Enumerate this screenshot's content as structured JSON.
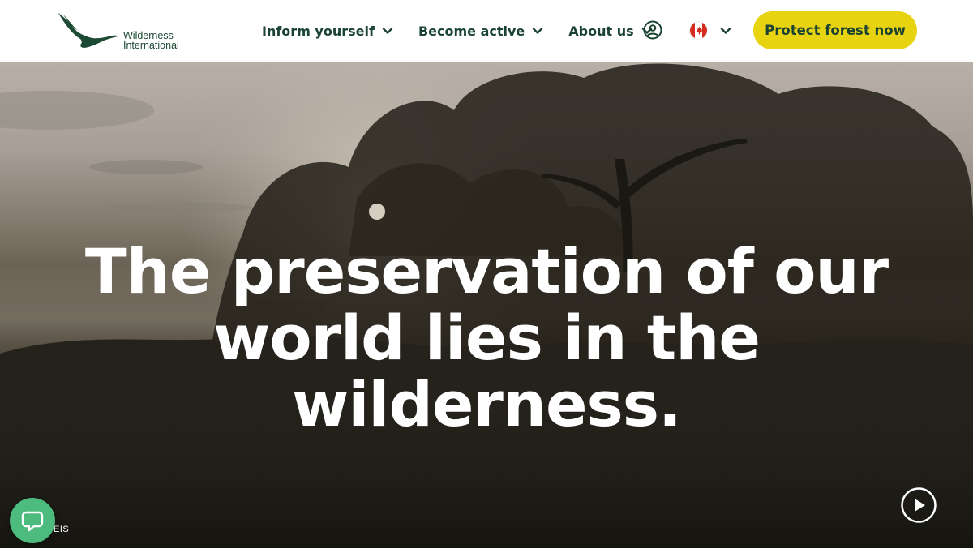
{
  "brand": {
    "line1": "Wilderness",
    "line2": "International",
    "color": "#1d4a35"
  },
  "nav": {
    "items": [
      {
        "label": "Inform yourself"
      },
      {
        "label": "Become active"
      },
      {
        "label": "About us"
      }
    ],
    "account_icon": "user-circle-icon",
    "language_icon": "canada-flag-icon"
  },
  "cta": {
    "label": "Protect forest now",
    "color": "#e8d311"
  },
  "hero": {
    "title_lines": [
      "The preservation of our",
      "world lies in the",
      "wilderness."
    ],
    "credit": "EIS",
    "play_icon": "play-icon"
  },
  "chat": {
    "icon": "chat-bubble-icon",
    "color": "#4dba7e"
  }
}
